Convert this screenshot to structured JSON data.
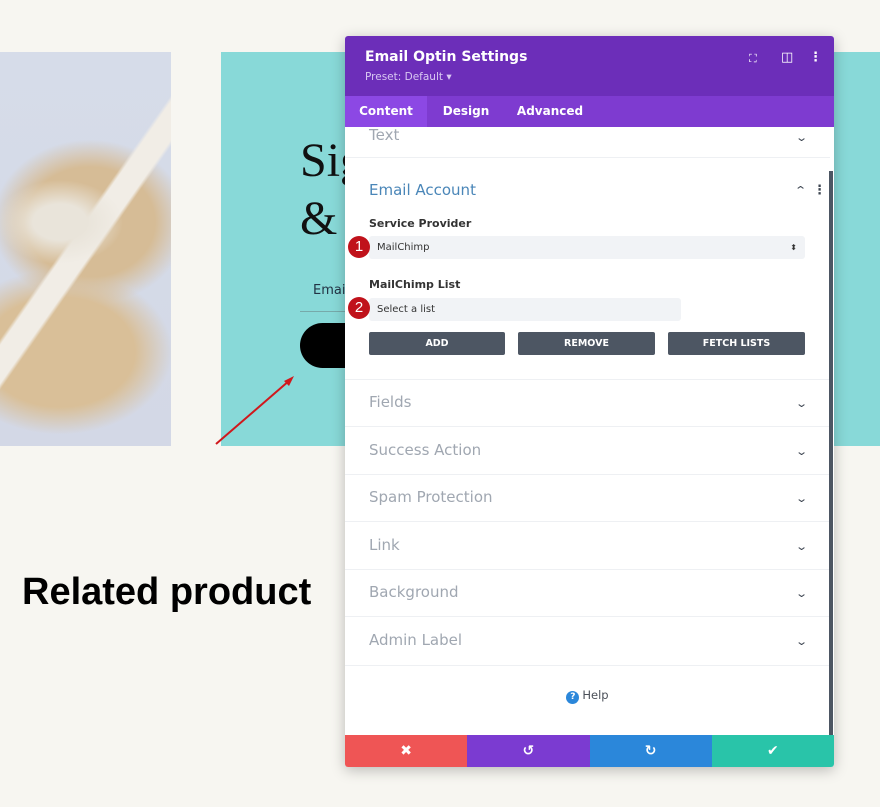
{
  "page": {
    "heading_fragment": "Sig",
    "ampersand": "&",
    "email_placeholder": "Email",
    "related_heading": "Related product"
  },
  "panel": {
    "title": "Email Optin Settings",
    "preset": "Preset: Default ▾",
    "header_icons": [
      "fullscreen-icon",
      "split-view-icon",
      "more-options-icon"
    ],
    "tabs": [
      {
        "label": "Content",
        "active": true
      },
      {
        "label": "Design"
      },
      {
        "label": "Advanced"
      }
    ],
    "sections": {
      "text": "Text",
      "email_account": "Email Account",
      "fields": "Fields",
      "success": "Success Action",
      "spam": "Spam Protection",
      "link": "Link",
      "background": "Background",
      "admin": "Admin Label"
    },
    "service_provider": {
      "label": "Service Provider",
      "value": "MailChimp"
    },
    "mailchimp_list": {
      "label": "MailChimp List",
      "value": "Select a list"
    },
    "buttons": {
      "add": "ADD",
      "remove": "REMOVE",
      "fetch": "FETCH LISTS"
    },
    "markers": [
      "1",
      "2"
    ],
    "help": "Help",
    "footer": {
      "cancel": "✖",
      "undo": "↺",
      "redo": "↻",
      "save": "✔"
    },
    "colors": {
      "header": "#6c2eb9",
      "tabs": "#7e3bd0",
      "cancel": "#ef5555",
      "undo": "#7b3bd1",
      "redo": "#2b87da",
      "save": "#29c4a9",
      "section_title": "#4a86b8",
      "teal_bg": "#88d9d8"
    }
  }
}
